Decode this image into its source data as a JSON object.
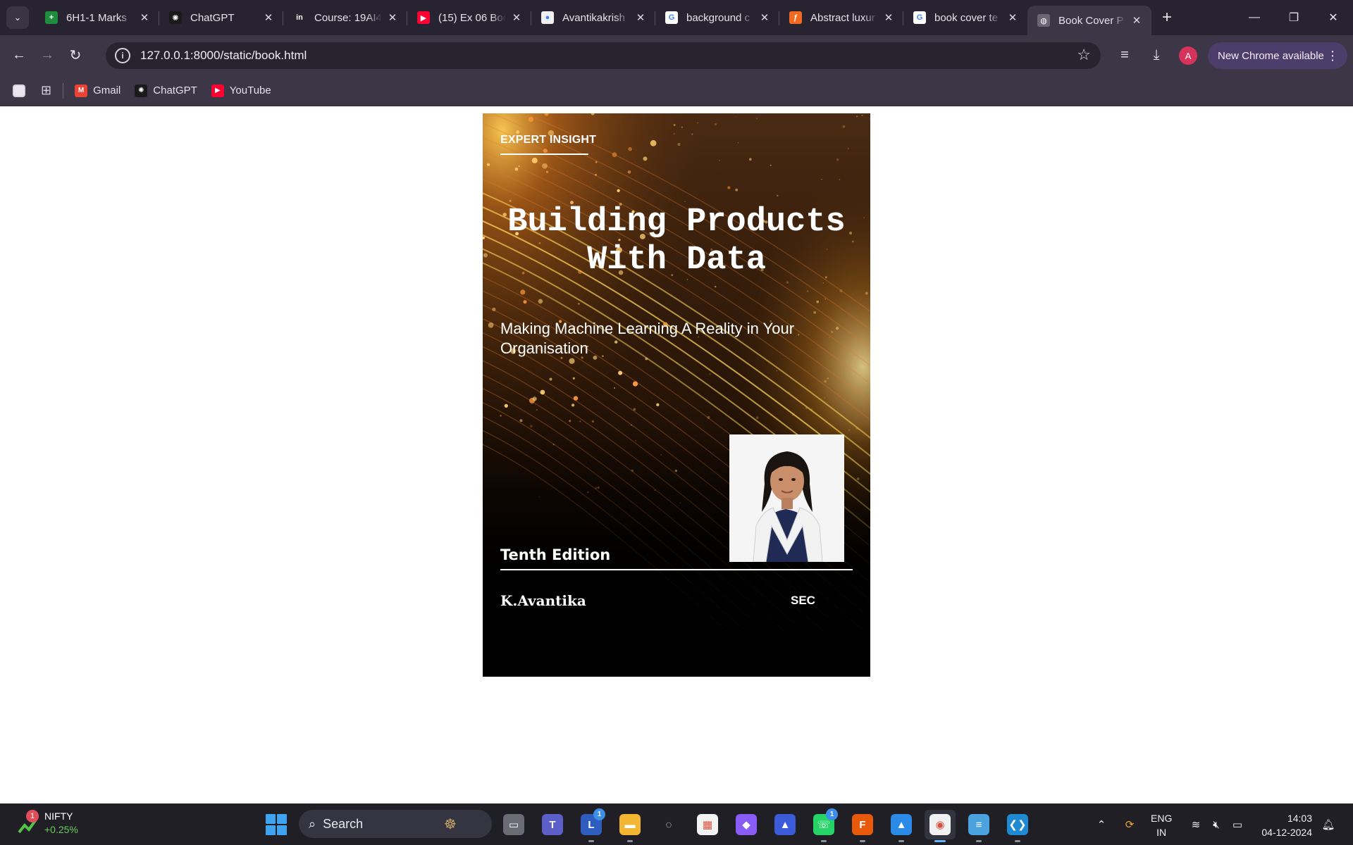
{
  "browser": {
    "tabs": [
      {
        "title": "6H1-1 Marks",
        "favicon": "sheets-icon",
        "color": "#1e8e3e",
        "glyph": "+"
      },
      {
        "title": "ChatGPT",
        "favicon": "chatgpt-icon",
        "color": "#1a1a1a",
        "glyph": "✺"
      },
      {
        "title": "Course: 19AI4",
        "favicon": "course-icon",
        "color": "#272330",
        "glyph": "in"
      },
      {
        "title": "(15) Ex 06 Boo",
        "favicon": "youtube-icon",
        "color": "#ff0033",
        "glyph": "▶"
      },
      {
        "title": "Avantikakrish",
        "favicon": "github-icon",
        "color": "#f0f0f0",
        "glyph": "●"
      },
      {
        "title": "background c",
        "favicon": "google-icon",
        "color": "#ffffff",
        "glyph": "G"
      },
      {
        "title": "Abstract luxur",
        "favicon": "freepik-icon",
        "color": "#f26a21",
        "glyph": "ƒ"
      },
      {
        "title": "book cover te",
        "favicon": "google-icon",
        "color": "#ffffff",
        "glyph": "G"
      },
      {
        "title": "Book Cover P",
        "favicon": "globe-icon",
        "color": "#6b6575",
        "glyph": "◍"
      }
    ],
    "active_tab": 8,
    "url": "127.0.0.1:8000/static/book.html",
    "update_label": "New Chrome available",
    "profile_initial": "A",
    "bookmarks": [
      {
        "label": "Gmail",
        "icon": "gmail-icon",
        "color": "#ea4335",
        "glyph": "M"
      },
      {
        "label": "ChatGPT",
        "icon": "chatgpt-icon",
        "color": "#1a1a1a",
        "glyph": "✺"
      },
      {
        "label": "YouTube",
        "icon": "youtube-icon",
        "color": "#ff0033",
        "glyph": "▶"
      }
    ]
  },
  "book": {
    "series": "EXPERT INSIGHT",
    "title_line1": "Building Products",
    "title_line2": "With Data",
    "subtitle": "Making Machine Learning A Reality in Your Organisation",
    "edition": "Tenth Edition",
    "author": "K.Avantika",
    "publisher": "SEC",
    "accent": "#ffb347"
  },
  "taskbar": {
    "widget_name": "NIFTY",
    "widget_change": "+0.25%",
    "widget_badge": "1",
    "search_placeholder": "Search",
    "lang_line1": "ENG",
    "lang_line2": "IN",
    "time": "14:03",
    "date": "04-12-2024",
    "apps": [
      {
        "name": "file-explorer-icon",
        "color": "#6b6b75",
        "glyph": "▭",
        "badge": ""
      },
      {
        "name": "teams-icon",
        "color": "#5b5fc7",
        "glyph": "T",
        "badge": ""
      },
      {
        "name": "l-app-icon",
        "color": "#2f5dbf",
        "glyph": "L",
        "badge": "1"
      },
      {
        "name": "folder-icon",
        "color": "#f2b632",
        "glyph": "▬",
        "badge": ""
      },
      {
        "name": "sync-app-icon",
        "color": "#1f1f25",
        "glyph": "◌",
        "badge": ""
      },
      {
        "name": "store-icon",
        "color": "#f3f3f3",
        "glyph": "▦",
        "badge": ""
      },
      {
        "name": "copilot-icon",
        "color": "#8a5cf6",
        "glyph": "◆",
        "badge": ""
      },
      {
        "name": "vpn-icon",
        "color": "#3b5bdb",
        "glyph": "▲",
        "badge": ""
      },
      {
        "name": "whatsapp-icon",
        "color": "#25d366",
        "glyph": "☏",
        "badge": "1"
      },
      {
        "name": "fplus-icon",
        "color": "#e8590c",
        "glyph": "F",
        "badge": ""
      },
      {
        "name": "photos-icon",
        "color": "#2b8ae6",
        "glyph": "▲",
        "badge": ""
      },
      {
        "name": "chrome-icon",
        "color": "#f1f1f1",
        "glyph": "◉",
        "badge": ""
      },
      {
        "name": "notepad-icon",
        "color": "#4aa3df",
        "glyph": "≡",
        "badge": ""
      },
      {
        "name": "vscode-icon",
        "color": "#1f8ad2",
        "glyph": "❮❯",
        "badge": ""
      }
    ],
    "active_app": 11
  }
}
